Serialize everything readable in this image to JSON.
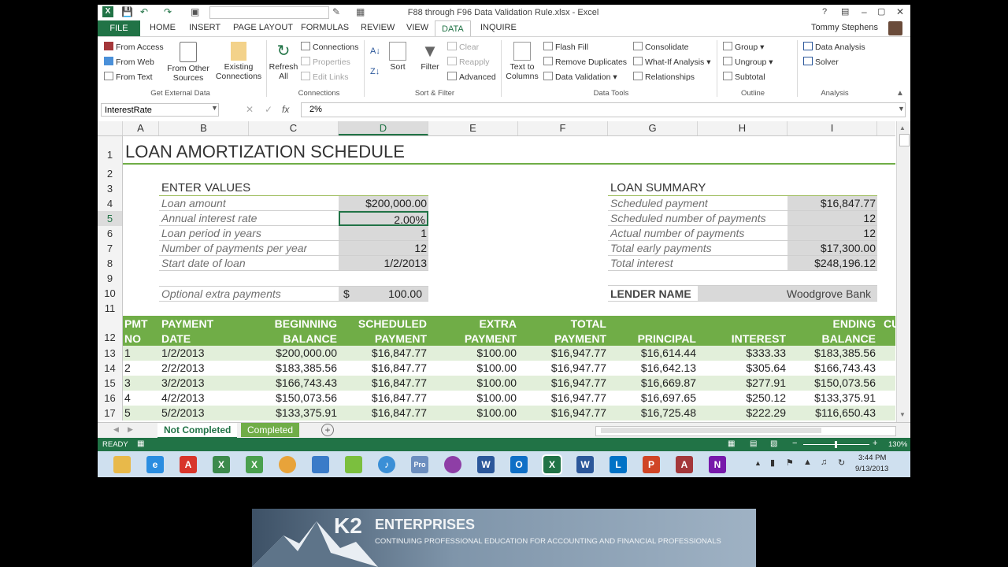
{
  "window": {
    "title": "F88 through F96 Data Validation Rule.xlsx - Excel",
    "help": "?",
    "restore_icon": "ribbon-display-icon",
    "min": "–",
    "max": "▢",
    "close": "✕"
  },
  "tabs": {
    "file": "FILE",
    "home": "HOME",
    "insert": "INSERT",
    "page_layout": "PAGE LAYOUT",
    "formulas": "FORMULAS",
    "review": "REVIEW",
    "view": "VIEW",
    "data": "DATA",
    "inquire": "INQUIRE",
    "user": "Tommy Stephens"
  },
  "ribbon": {
    "get_external": {
      "from_access": "From Access",
      "from_web": "From Web",
      "from_text": "From Text",
      "from_other_1": "From Other",
      "from_other_2": "Sources",
      "existing_1": "Existing",
      "existing_2": "Connections",
      "label": "Get External Data"
    },
    "connections": {
      "refresh_1": "Refresh",
      "refresh_2": "All",
      "connections": "Connections",
      "properties": "Properties",
      "edit_links": "Edit Links",
      "label": "Connections"
    },
    "sort_filter": {
      "sort": "Sort",
      "filter": "Filter",
      "clear": "Clear",
      "reapply": "Reapply",
      "advanced": "Advanced",
      "label": "Sort & Filter"
    },
    "data_tools": {
      "text_col_1": "Text to",
      "text_col_2": "Columns",
      "flash_fill": "Flash Fill",
      "remove_dup": "Remove Duplicates",
      "data_validation": "Data Validation",
      "consolidate": "Consolidate",
      "what_if": "What-If Analysis",
      "relationships": "Relationships",
      "label": "Data Tools"
    },
    "outline": {
      "group": "Group",
      "ungroup": "Ungroup",
      "subtotal": "Subtotal",
      "label": "Outline"
    },
    "analysis": {
      "data_analysis": "Data Analysis",
      "solver": "Solver",
      "label": "Analysis"
    }
  },
  "formula_bar": {
    "name_box": "InterestRate",
    "formula": "2%",
    "fx": "fx"
  },
  "columns": [
    "A",
    "B",
    "C",
    "D",
    "E",
    "F",
    "G",
    "H",
    "I"
  ],
  "rows": [
    "1",
    "2",
    "3",
    "4",
    "5",
    "6",
    "7",
    "8",
    "9",
    "10",
    "11",
    "12",
    "13",
    "14",
    "15",
    "16",
    "17"
  ],
  "sheet": {
    "title": "LOAN AMORTIZATION SCHEDULE",
    "enter_values": "ENTER VALUES",
    "inputs": [
      {
        "label": "Loan amount",
        "value": "$200,000.00"
      },
      {
        "label": "Annual interest rate",
        "value": "2.00%"
      },
      {
        "label": "Loan period in years",
        "value": "1"
      },
      {
        "label": "Number of payments per year",
        "value": "12"
      },
      {
        "label": "Start date of loan",
        "value": "1/2/2013"
      }
    ],
    "extra": {
      "label": "Optional extra payments",
      "currency": "$",
      "value": "100.00"
    },
    "loan_summary": "LOAN SUMMARY",
    "summary": [
      {
        "label": "Scheduled payment",
        "value": "$16,847.77"
      },
      {
        "label": "Scheduled number of payments",
        "value": "12"
      },
      {
        "label": "Actual number of payments",
        "value": "12"
      },
      {
        "label": "Total early payments",
        "value": "$17,300.00"
      },
      {
        "label": "Total interest",
        "value": "$248,196.12"
      }
    ],
    "lender": {
      "label": "LENDER NAME",
      "value": "Woodgrove Bank"
    },
    "headers": {
      "pmt_1": "PMT",
      "pmt_2": "NO",
      "date_1": "PAYMENT",
      "date_2": "DATE",
      "beg_1": "BEGINNING",
      "beg_2": "BALANCE",
      "sch_1": "SCHEDULED",
      "sch_2": "PAYMENT",
      "ext_1": "EXTRA",
      "ext_2": "PAYMENT",
      "tot_1": "TOTAL",
      "tot_2": "PAYMENT",
      "principal": "PRINCIPAL",
      "interest": "INTEREST",
      "end_1": "ENDING",
      "end_2": "BALANCE",
      "cut": "CU"
    },
    "table": [
      [
        "1",
        "1/2/2013",
        "$200,000.00",
        "$16,847.77",
        "$100.00",
        "$16,947.77",
        "$16,614.44",
        "$333.33",
        "$183,385.56"
      ],
      [
        "2",
        "2/2/2013",
        "$183,385.56",
        "$16,847.77",
        "$100.00",
        "$16,947.77",
        "$16,642.13",
        "$305.64",
        "$166,743.43"
      ],
      [
        "3",
        "3/2/2013",
        "$166,743.43",
        "$16,847.77",
        "$100.00",
        "$16,947.77",
        "$16,669.87",
        "$277.91",
        "$150,073.56"
      ],
      [
        "4",
        "4/2/2013",
        "$150,073.56",
        "$16,847.77",
        "$100.00",
        "$16,947.77",
        "$16,697.65",
        "$250.12",
        "$133,375.91"
      ],
      [
        "5",
        "5/2/2013",
        "$133,375.91",
        "$16,847.77",
        "$100.00",
        "$16,947.77",
        "$16,725.48",
        "$222.29",
        "$116,650.43"
      ]
    ]
  },
  "sheet_tabs": {
    "tab1": "Not Completed",
    "tab2": "Completed",
    "add": "+"
  },
  "status": {
    "ready": "READY",
    "zoom": "130%"
  },
  "taskbar": {
    "time": "3:44 PM",
    "date": "9/13/2013"
  },
  "banner": {
    "brand_k2": "K2",
    "brand_name": "ENTERPRISES",
    "tagline": "CONTINUING PROFESSIONAL EDUCATION FOR ACCOUNTING AND FINANCIAL PROFESSIONALS"
  },
  "colors": {
    "excel_green": "#217346",
    "table_green": "#70ad47",
    "row_band": "#e2efda",
    "input_gray": "#d9d9d9"
  }
}
